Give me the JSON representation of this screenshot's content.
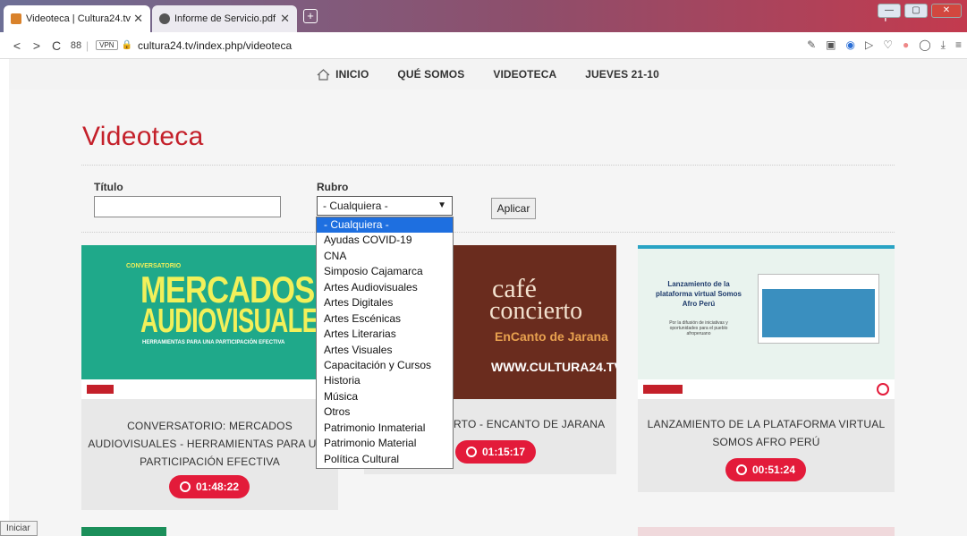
{
  "browser": {
    "tabs": [
      {
        "label": "Videoteca | Cultura24.tv",
        "close": "✕"
      },
      {
        "label": "Informe de Servicio.pdf",
        "close": "✕"
      }
    ],
    "new_tab": "+",
    "window_controls": {
      "minimize": "—",
      "maximize": "▢",
      "close": "✕"
    },
    "nav": {
      "back": "<",
      "forward": ">",
      "reload": "C",
      "grid": "88",
      "vpn": "VPN"
    },
    "url": "cultura24.tv/index.php/videoteca"
  },
  "site_nav": {
    "items": [
      "INICIO",
      "QUÉ SOMOS",
      "VIDEOTECA",
      "JUEVES 21-10"
    ]
  },
  "page": {
    "title": "Videoteca",
    "filter": {
      "titulo_label": "Título",
      "titulo_value": "",
      "rubro_label": "Rubro",
      "rubro_selected": "- Cualquiera -",
      "apply_label": "Aplicar"
    },
    "dropdown_options": [
      "- Cualquiera -",
      "Ayudas COVID-19",
      "CNA",
      "Simposio Cajamarca",
      "Artes Audiovisuales",
      "Artes Digitales",
      "Artes Escénicas",
      "Artes Literarias",
      "Artes Visuales",
      "Capacitación y Cursos",
      "Historia",
      "Música",
      "Otros",
      "Patrimonio Inmaterial",
      "Patrimonio Material",
      "Política Cultural"
    ]
  },
  "videos": [
    {
      "thumb_top": "CONVERSATORIO",
      "thumb_title1": "MERCADOS",
      "thumb_title2": "AUDIOVISUALES",
      "thumb_sub": "HERRAMIENTAS PARA UNA PARTICIPACIÓN EFECTIVA",
      "title_lines": [
        "CONVERSATORIO: MERCADOS",
        "AUDIOVISUALES - HERRAMIENTAS PARA UNA",
        "PARTICIPACIÓN EFECTIVA"
      ],
      "duration": "01:48:22"
    },
    {
      "thumb_title1": "café",
      "thumb_title2": "concierto",
      "thumb_sub": "EnCanto de Jarana",
      "thumb_url": "WWW.CULTURA24.TV",
      "title_lines": [
        "RTO - ENCANTO DE JARANA"
      ],
      "duration": "01:15:17"
    },
    {
      "thumb_title": "Lanzamiento de la plataforma virtual Somos Afro Perú",
      "thumb_sub": "Por la difusión de iniciativas y oportunidades para el pueblo afroperuano",
      "title_lines": [
        "LANZAMIENTO DE LA PLATAFORMA VIRTUAL",
        "SOMOS AFRO PERÚ"
      ],
      "duration": "00:51:24"
    }
  ],
  "taskbar": {
    "label": "Iniciar"
  },
  "colors": {
    "accent": "#c4202a",
    "badge": "#e31b3a",
    "dropdown_selected": "#1e6fe0"
  }
}
